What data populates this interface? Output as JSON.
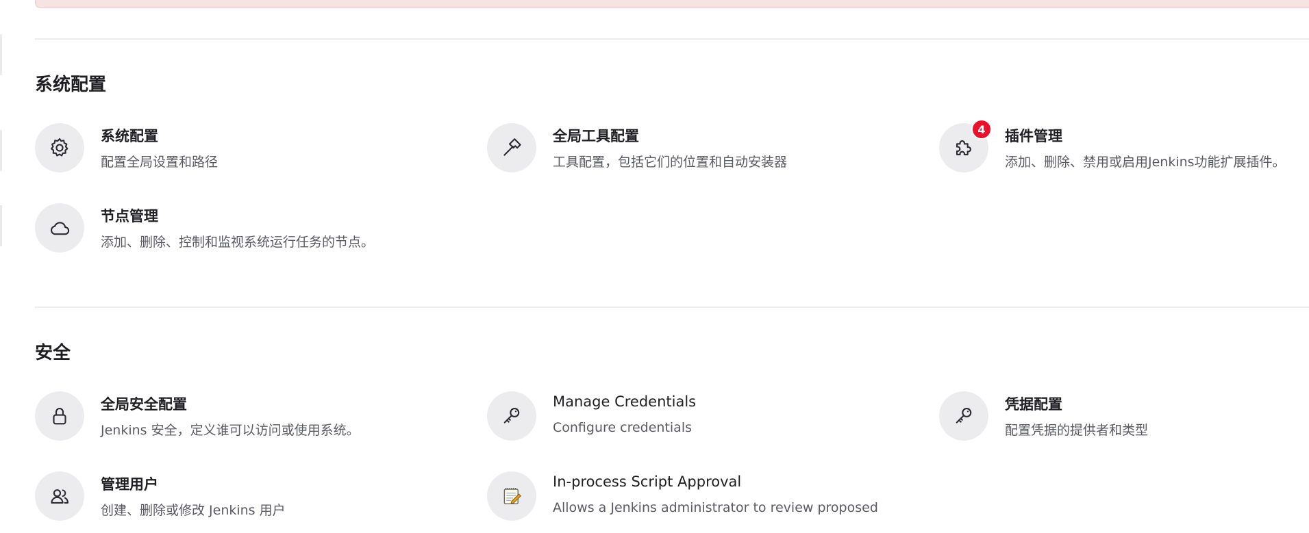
{
  "sections": [
    {
      "title": "系统配置",
      "items": [
        {
          "title": "系统配置",
          "description": "配置全局设置和路径",
          "icon": "gear-icon"
        },
        {
          "title": "全局工具配置",
          "description": "工具配置，包括它们的位置和自动安装器",
          "icon": "hammer-icon"
        },
        {
          "title": "插件管理",
          "description": "添加、删除、禁用或启用Jenkins功能扩展插件。",
          "icon": "puzzle-icon",
          "badge": "4"
        },
        {
          "title": "节点管理",
          "description": "添加、删除、控制和监视系统运行任务的节点。",
          "icon": "cloud-icon"
        }
      ]
    },
    {
      "title": "安全",
      "items": [
        {
          "title": "全局安全配置",
          "description": "Jenkins 安全，定义谁可以访问或使用系统。",
          "icon": "lock-icon"
        },
        {
          "title": "Manage Credentials",
          "description": "Configure credentials",
          "icon": "key-icon"
        },
        {
          "title": "凭据配置",
          "description": "配置凭据的提供者和类型",
          "icon": "key-icon"
        },
        {
          "title": "管理用户",
          "description": "创建、删除或修改 Jenkins 用户",
          "icon": "users-icon"
        },
        {
          "title": "In-process Script Approval",
          "description": "Allows a Jenkins administrator to review proposed",
          "icon": "notepad-icon"
        }
      ]
    }
  ],
  "colors": {
    "badge": "#e8122d",
    "icon_bg": "#ececee",
    "alert_bg": "#f8e3e3",
    "divider": "#ececec"
  }
}
